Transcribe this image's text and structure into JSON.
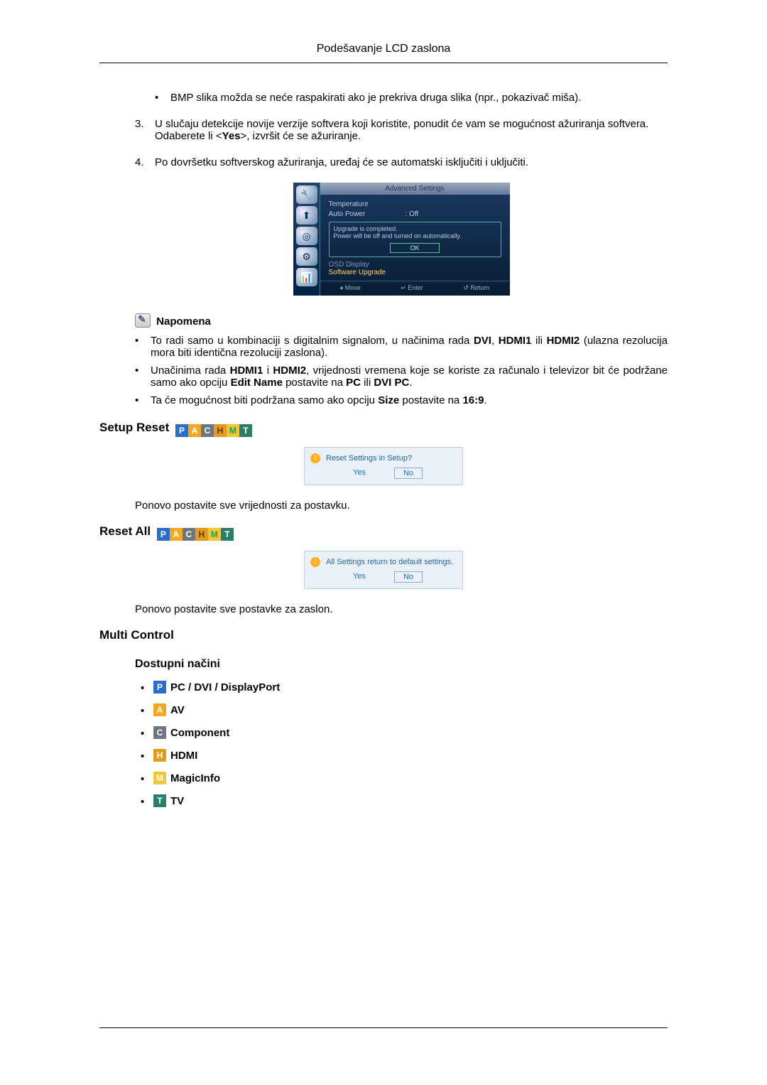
{
  "header": {
    "title": "Podešavanje LCD zaslona"
  },
  "intro_bullet": "BMP slika možda se neće raspakirati ako je prekriva druga slika (npr., pokazivač miša).",
  "step3": {
    "num": "3.",
    "text_parts": [
      "U slučaju detekcije novije verzije softvera koji koristite, ponudit će vam se mogućnost ažuriranja softvera. Odaberete li <",
      ">, izvršit će se ažuriranje."
    ],
    "bold": "Yes"
  },
  "step4": {
    "num": "4.",
    "text": "Po dovršetku softverskog ažuriranja, uređaj će se automatski isključiti i uključiti."
  },
  "osd": {
    "tab": "Advanced Settings",
    "rows": [
      {
        "label": "Temperature",
        "value": ""
      },
      {
        "label": "Auto Power",
        "value": ": Off"
      }
    ],
    "box_line1": "Upgrade is completed.",
    "box_line2": "Power will be off and turned on automatically.",
    "ok": "OK",
    "below": [
      "OSD Display",
      "Software Upgrade"
    ],
    "footer": [
      "♦ Move",
      "↵ Enter",
      "↺ Return"
    ]
  },
  "note": {
    "label": "Napomena",
    "items": [
      {
        "pre": "To radi samo u kombinaciji s digitalnim signalom, u načinima rada ",
        "b1": "DVI",
        "mid1": ", ",
        "b2": "HDMI1",
        "mid2": " ili ",
        "b3": "HDMI2",
        "post": " (ulazna rezolucija mora biti identična rezoluciji zaslona)."
      },
      {
        "pre": "Unačinima rada ",
        "b1": "HDMI1",
        "mid1": " i ",
        "b2": "HDMI2",
        "mid2": ", vrijednosti vremena koje se koriste za računalo i televizor bit će podržane samo ako opciju ",
        "b3": "Edit Name",
        "mid3": " postavite na ",
        "b4": "PC",
        "mid4": " ili ",
        "b5": "DVI PC",
        "post": "."
      },
      {
        "pre": "Ta će mogućnost biti podržana samo ako opciju ",
        "b1": "Size",
        "mid1": " postavite na ",
        "b2": "16:9",
        "post": "."
      }
    ]
  },
  "setup_reset": {
    "title": "Setup Reset",
    "dialog_msg": "Reset Settings in Setup?",
    "yes": "Yes",
    "no": "No",
    "desc": "Ponovo postavite sve vrijednosti za postavku."
  },
  "reset_all": {
    "title": "Reset All",
    "dialog_msg": "All Settings return to default settings.",
    "yes": "Yes",
    "no": "No",
    "desc": "Ponovo postavite sve postavke za zaslon."
  },
  "multi_control": {
    "title": "Multi Control",
    "sub": "Dostupni načini",
    "modes": [
      {
        "letter": "P",
        "cls": "b-p",
        "label": " PC / DVI / DisplayPort"
      },
      {
        "letter": "A",
        "cls": "b-a",
        "label": " AV"
      },
      {
        "letter": "C",
        "cls": "b-c",
        "label": " Component"
      },
      {
        "letter": "H",
        "cls": "b-h",
        "label": " HDMI"
      },
      {
        "letter": "M",
        "cls": "b-m",
        "label": " MagicInfo"
      },
      {
        "letter": "T",
        "cls": "b-t",
        "label": " TV"
      }
    ]
  },
  "badges": [
    "P",
    "A",
    "C",
    "H",
    "M",
    "T"
  ]
}
